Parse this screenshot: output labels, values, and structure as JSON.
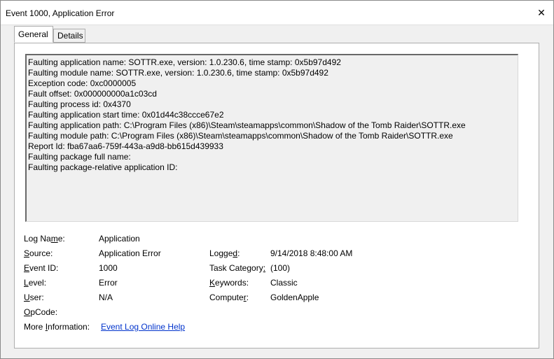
{
  "window": {
    "title": "Event 1000, Application Error",
    "close_glyph": "✕"
  },
  "tabs": [
    {
      "label": "General",
      "active": true
    },
    {
      "label": "Details",
      "active": false
    }
  ],
  "description_lines": [
    "Faulting application name: SOTTR.exe, version: 1.0.230.6, time stamp: 0x5b97d492",
    "Faulting module name: SOTTR.exe, version: 1.0.230.6, time stamp: 0x5b97d492",
    "Exception code: 0xc0000005",
    "Fault offset: 0x000000000a1c03cd",
    "Faulting process id: 0x4370",
    "Faulting application start time: 0x01d44c38ccce67e2",
    "Faulting application path: C:\\Program Files (x86)\\Steam\\steamapps\\common\\Shadow of the Tomb Raider\\SOTTR.exe",
    "Faulting module path: C:\\Program Files (x86)\\Steam\\steamapps\\common\\Shadow of the Tomb Raider\\SOTTR.exe",
    "Report Id: fba67aa6-759f-443a-a9d8-bb615d439933",
    "Faulting package full name: ",
    "Faulting package-relative application ID: "
  ],
  "properties": {
    "log_name": {
      "label_pre": "Log Na",
      "label_u": "m",
      "label_post": "e:",
      "value": "Application"
    },
    "source": {
      "label_pre": "",
      "label_u": "S",
      "label_post": "ource:",
      "value": "Application Error"
    },
    "event_id": {
      "label_pre": "",
      "label_u": "E",
      "label_post": "vent ID:",
      "value": "1000"
    },
    "level": {
      "label_pre": "",
      "label_u": "L",
      "label_post": "evel:",
      "value": "Error"
    },
    "user": {
      "label_pre": "",
      "label_u": "U",
      "label_post": "ser:",
      "value": "N/A"
    },
    "opcode": {
      "label_pre": "",
      "label_u": "O",
      "label_post": "pCode:",
      "value": ""
    },
    "more_info": {
      "label_pre": "More ",
      "label_u": "I",
      "label_post": "nformation:",
      "link": "Event Log Online Help"
    },
    "logged": {
      "label_pre": "Logge",
      "label_u": "d",
      "label_post": ":",
      "value": "9/14/2018 8:48:00 AM"
    },
    "task_category": {
      "label_pre": "Task Category",
      "label_u": ":",
      "label_post": "",
      "value": "(100)"
    },
    "keywords": {
      "label_pre": "",
      "label_u": "K",
      "label_post": "eywords:",
      "value": "Classic"
    },
    "computer": {
      "label_pre": "Compute",
      "label_u": "r",
      "label_post": ":",
      "value": "GoldenApple"
    }
  }
}
